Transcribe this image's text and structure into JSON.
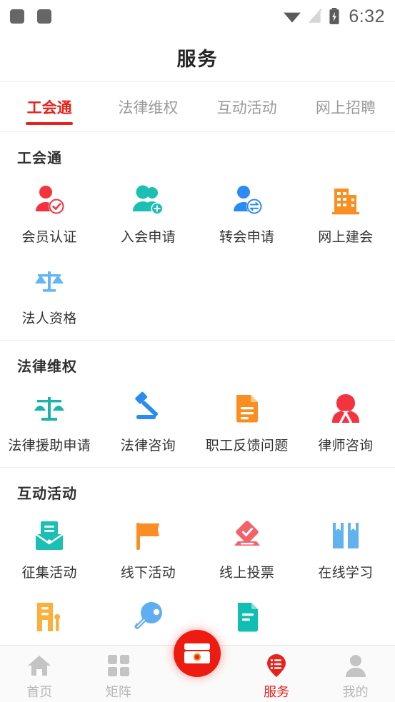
{
  "statusbar": {
    "time": "6:32",
    "icons": [
      "notification-square",
      "notification-square",
      "wifi-icon",
      "signal-off-icon",
      "battery-charging-icon"
    ]
  },
  "header": {
    "title": "服务"
  },
  "tabs": [
    {
      "label": "工会通",
      "active": true
    },
    {
      "label": "法律维权",
      "active": false
    },
    {
      "label": "互动活动",
      "active": false
    },
    {
      "label": "网上招聘",
      "active": false
    }
  ],
  "sections": [
    {
      "title": "工会通",
      "items": [
        {
          "label": "会员认证",
          "icon": "member-verify-icon",
          "color": "#f5333f"
        },
        {
          "label": "入会申请",
          "icon": "join-union-icon",
          "color": "#1cbfb4"
        },
        {
          "label": "转会申请",
          "icon": "transfer-union-icon",
          "color": "#2a8cf0"
        },
        {
          "label": "网上建会",
          "icon": "build-union-icon",
          "color": "#f98f23"
        },
        {
          "label": "法人资格",
          "icon": "legal-entity-icon",
          "color": "#64b5f6"
        }
      ]
    },
    {
      "title": "法律维权",
      "items": [
        {
          "label": "法律援助申请",
          "icon": "legal-aid-scales-icon",
          "color": "#15b5ac"
        },
        {
          "label": "法律咨询",
          "icon": "gavel-icon",
          "color": "#2a8cf0"
        },
        {
          "label": "职工反馈问题",
          "icon": "feedback-document-icon",
          "color": "#f98f23"
        },
        {
          "label": "律师咨询",
          "icon": "lawyer-icon",
          "color": "#f5333f"
        }
      ]
    },
    {
      "title": "互动活动",
      "items": [
        {
          "label": "征集活动",
          "icon": "collect-envelope-icon",
          "color": "#1cbfb4"
        },
        {
          "label": "线下活动",
          "icon": "flag-icon",
          "color": "#f98f23"
        },
        {
          "label": "线上投票",
          "icon": "vote-icon",
          "color": "#f4616a"
        },
        {
          "label": "在线学习",
          "icon": "book-icon",
          "color": "#60b3ef"
        },
        {
          "label": "",
          "icon": "hotel-building-icon",
          "color": "#fbb03b"
        },
        {
          "label": "",
          "icon": "pingpong-paddle-icon",
          "color": "#60aef2"
        },
        {
          "label": "",
          "icon": "document-icon",
          "color": "#12bdb2"
        }
      ]
    }
  ],
  "bottomnav": {
    "items": [
      {
        "label": "首页",
        "icon": "home-icon",
        "active": false
      },
      {
        "label": "矩阵",
        "icon": "grid-icon",
        "active": false
      },
      {
        "label": "服务",
        "icon": "service-pin-icon",
        "active": true
      },
      {
        "label": "我的",
        "icon": "profile-icon",
        "active": false
      }
    ],
    "fab": {
      "icon": "wallet-card-icon",
      "color": "#ee1b11"
    }
  },
  "colors": {
    "accent": "#e8231c",
    "text": "#333333",
    "muted": "#9a9a9a"
  }
}
